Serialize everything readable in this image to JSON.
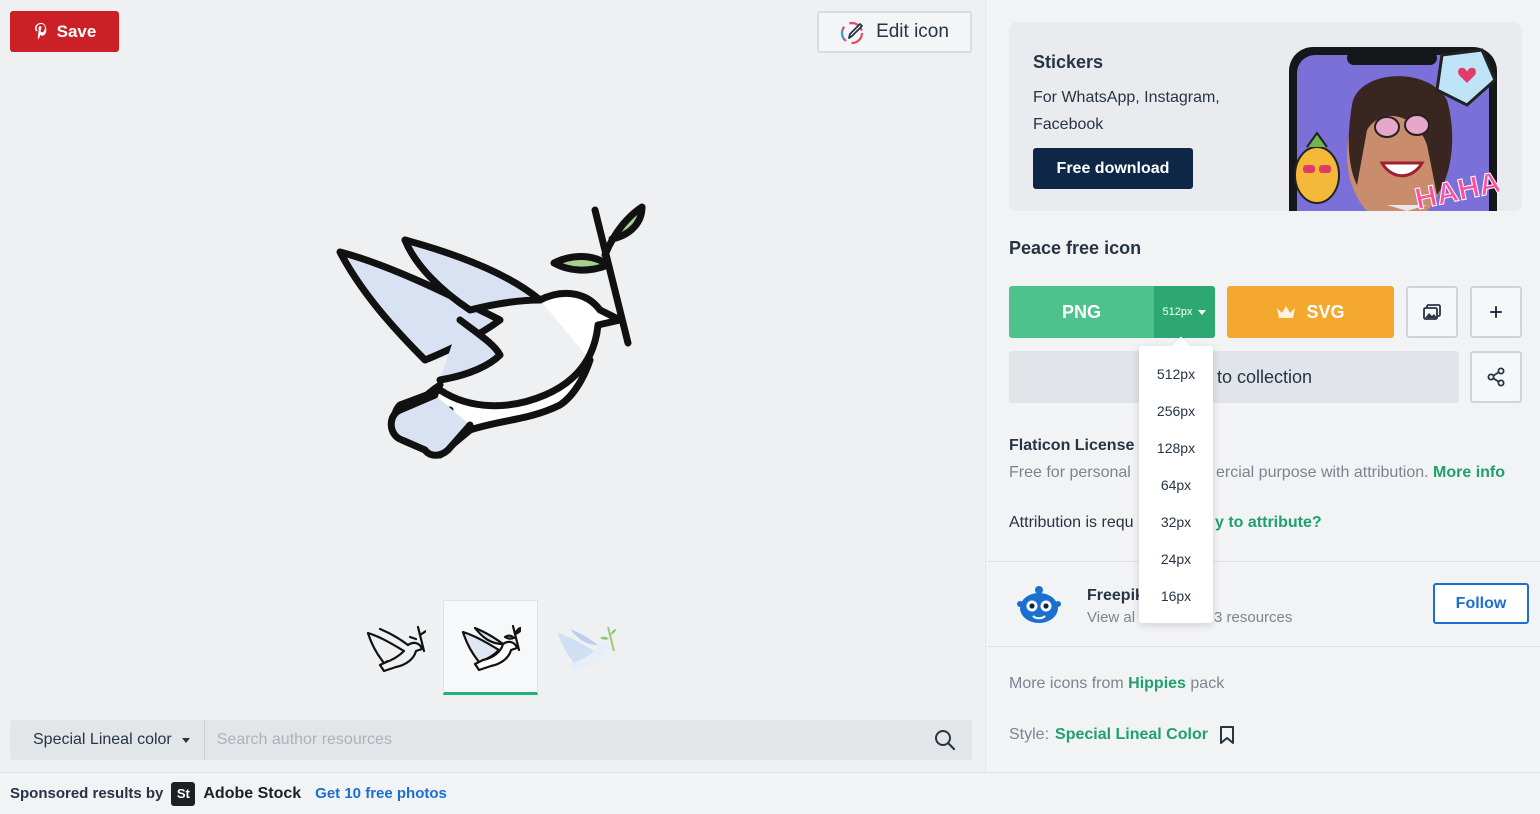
{
  "left": {
    "save_label": "Save",
    "edit_label": "Edit icon",
    "style_select": "Special Lineal color",
    "search_placeholder": "Search author resources"
  },
  "sponsored": {
    "label": "Sponsored results by",
    "logo_text": "St",
    "brand": "Adobe Stock",
    "link": "Get 10 free photos"
  },
  "promo": {
    "title": "Stickers",
    "subtitle": "For WhatsApp, Instagram, Facebook",
    "button": "Free download",
    "haha_text": "HAHA"
  },
  "icon_title": "Peace free icon",
  "download": {
    "png_label": "PNG",
    "png_size": "512px",
    "svg_label": "SVG",
    "collection_label": "to collection"
  },
  "size_options": [
    "512px",
    "256px",
    "128px",
    "64px",
    "32px",
    "24px",
    "16px"
  ],
  "license": {
    "title": "Flaticon License",
    "text_left": "Free for personal",
    "text_right": "ercial purpose with attribution.",
    "more_info": "More info",
    "attrib_left": "Attribution is requ",
    "attrib_link": "y to attribute?"
  },
  "author": {
    "name": "Freepik",
    "sub_left": "View al",
    "sub_right": "3 resources",
    "follow": "Follow"
  },
  "more_pack": {
    "prefix": "More icons from",
    "pack": "Hippies",
    "suffix": "pack"
  },
  "style": {
    "label": "Style:",
    "value": "Special Lineal Color"
  },
  "colors": {
    "save_red": "#cc2027",
    "png_green": "#4dc28d",
    "svg_orange": "#f4a82e",
    "navy": "#0f2747",
    "link_green": "#1fa06c",
    "link_blue": "#1a6fd1"
  }
}
